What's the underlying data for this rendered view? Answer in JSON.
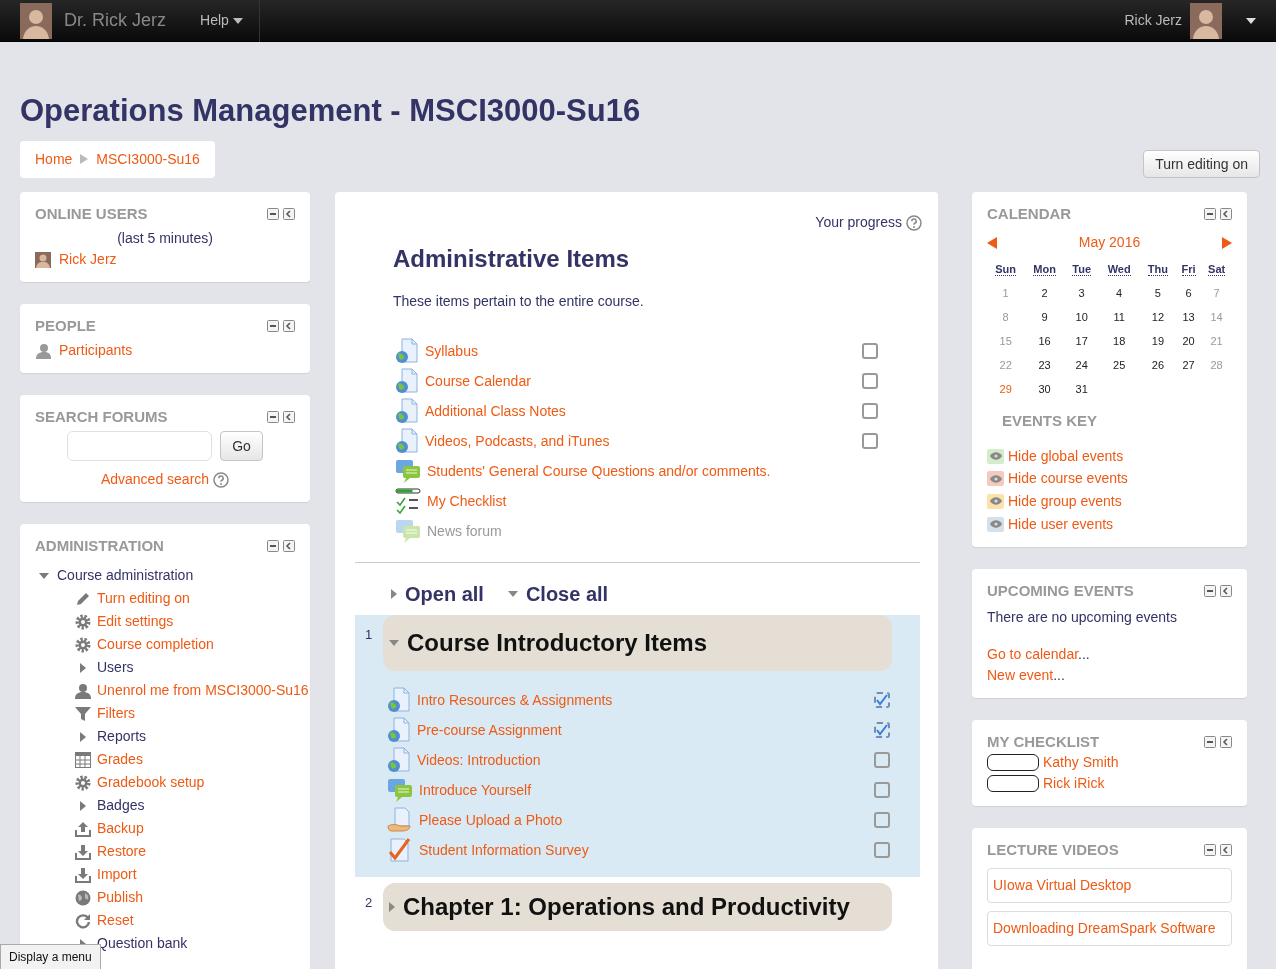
{
  "navbar": {
    "brand": "Dr. Rick Jerz",
    "menu": [
      {
        "label": "Help"
      }
    ],
    "user_name": "Rick Jerz"
  },
  "page_title": "Operations Management - MSCI3000-Su16",
  "breadcrumb": [
    "Home",
    "MSCI3000-Su16"
  ],
  "edit_button": "Turn editing on",
  "online_users": {
    "title": "ONLINE USERS",
    "period": "(last 5 minutes)",
    "users": [
      "Rick Jerz"
    ]
  },
  "people": {
    "title": "PEOPLE",
    "link": "Participants"
  },
  "search_forums": {
    "title": "SEARCH FORUMS",
    "button": "Go",
    "advanced": "Advanced search"
  },
  "administration": {
    "title": "ADMINISTRATION",
    "tree": [
      {
        "label": "Course administration",
        "kind": "branch",
        "expanded": true,
        "children": [
          {
            "label": "Turn editing on",
            "kind": "edit"
          },
          {
            "label": "Edit settings",
            "kind": "settings"
          },
          {
            "label": "Course completion",
            "kind": "settings"
          },
          {
            "label": "Users",
            "kind": "branch",
            "expanded": false
          },
          {
            "label": "Unenrol me from MSCI3000-Su16",
            "kind": "user"
          },
          {
            "label": "Filters",
            "kind": "filter"
          },
          {
            "label": "Reports",
            "kind": "branch",
            "expanded": false
          },
          {
            "label": "Grades",
            "kind": "grades"
          },
          {
            "label": "Gradebook setup",
            "kind": "settings"
          },
          {
            "label": "Badges",
            "kind": "branch",
            "expanded": false
          },
          {
            "label": "Backup",
            "kind": "backup"
          },
          {
            "label": "Restore",
            "kind": "restore"
          },
          {
            "label": "Import",
            "kind": "restore"
          },
          {
            "label": "Publish",
            "kind": "publish"
          },
          {
            "label": "Reset",
            "kind": "reset"
          },
          {
            "label": "Question bank",
            "kind": "branch",
            "expanded": false
          }
        ]
      }
    ]
  },
  "course": {
    "progress_label": "Your progress",
    "intro_section": {
      "title": "Administrative Items",
      "summary": "These items pertain to the entire course.",
      "activities": [
        {
          "name": "Syllabus",
          "kind": "url",
          "hidden": false,
          "completion": {
            "checked": false,
            "automatic": false
          }
        },
        {
          "name": "Course Calendar",
          "kind": "url",
          "hidden": false,
          "completion": {
            "checked": false,
            "automatic": false
          }
        },
        {
          "name": "Additional Class Notes",
          "kind": "url",
          "hidden": false,
          "completion": {
            "checked": false,
            "automatic": false
          }
        },
        {
          "name": "Videos, Podcasts, and iTunes",
          "kind": "url",
          "hidden": false,
          "completion": {
            "checked": false,
            "automatic": false
          }
        },
        {
          "name": "Students' General Course Questions and/or comments.",
          "kind": "forum",
          "hidden": false
        },
        {
          "name": "My Checklist",
          "kind": "checklist",
          "hidden": false
        },
        {
          "name": "News forum",
          "kind": "forum",
          "hidden": true
        }
      ]
    },
    "open_all": "Open all",
    "close_all": "Close all",
    "sections": [
      {
        "number": "1",
        "title": "Course Introductory Items",
        "expanded": true,
        "current": true,
        "activities": [
          {
            "name": "Intro Resources & Assignments",
            "kind": "url",
            "hidden": false,
            "completion": {
              "checked": true,
              "automatic": true
            }
          },
          {
            "name": "Pre-course Assignment",
            "kind": "url",
            "hidden": false,
            "completion": {
              "checked": true,
              "automatic": true
            }
          },
          {
            "name": "Videos: Introduction",
            "kind": "url",
            "hidden": false,
            "completion": {
              "checked": false,
              "automatic": false
            }
          },
          {
            "name": "Introduce Yourself",
            "kind": "forum",
            "hidden": false,
            "completion": {
              "checked": false,
              "automatic": false
            }
          },
          {
            "name": "Please Upload a Photo",
            "kind": "assign",
            "hidden": false,
            "completion": {
              "checked": false,
              "automatic": false
            }
          },
          {
            "name": "Student Information Survey",
            "kind": "survey",
            "hidden": false,
            "completion": {
              "checked": false,
              "automatic": false
            }
          }
        ]
      },
      {
        "number": "2",
        "title": "Chapter 1: Operations and Productivity",
        "expanded": false,
        "current": false
      }
    ]
  },
  "calendar": {
    "title": "CALENDAR",
    "month": "May 2016",
    "weekdays": [
      "Sun",
      "Mon",
      "Tue",
      "Wed",
      "Thu",
      "Fri",
      "Sat"
    ],
    "weeks": [
      [
        {
          "day": "1",
          "today": false
        },
        {
          "day": "2",
          "today": false
        },
        {
          "day": "3",
          "today": false
        },
        {
          "day": "4",
          "today": false
        },
        {
          "day": "5",
          "today": false
        },
        {
          "day": "6",
          "today": false
        },
        {
          "day": "7",
          "today": false
        }
      ],
      [
        {
          "day": "8",
          "today": false
        },
        {
          "day": "9",
          "today": false
        },
        {
          "day": "10",
          "today": false
        },
        {
          "day": "11",
          "today": false
        },
        {
          "day": "12",
          "today": false
        },
        {
          "day": "13",
          "today": false
        },
        {
          "day": "14",
          "today": false
        }
      ],
      [
        {
          "day": "15",
          "today": false
        },
        {
          "day": "16",
          "today": false
        },
        {
          "day": "17",
          "today": false
        },
        {
          "day": "18",
          "today": false
        },
        {
          "day": "19",
          "today": false
        },
        {
          "day": "20",
          "today": false
        },
        {
          "day": "21",
          "today": false
        }
      ],
      [
        {
          "day": "22",
          "today": false
        },
        {
          "day": "23",
          "today": false
        },
        {
          "day": "24",
          "today": false
        },
        {
          "day": "25",
          "today": false
        },
        {
          "day": "26",
          "today": false
        },
        {
          "day": "27",
          "today": false
        },
        {
          "day": "28",
          "today": false
        }
      ],
      [
        {
          "day": "29",
          "today": true
        },
        {
          "day": "30",
          "today": false
        },
        {
          "day": "31",
          "today": false
        }
      ]
    ],
    "events_key_title": "EVENTS KEY",
    "events_key": [
      {
        "label": "Hide global events",
        "color": "#d3ecc9"
      },
      {
        "label": "Hide course events",
        "color": "#f5c9bf"
      },
      {
        "label": "Hide group events",
        "color": "#fbe2aa"
      },
      {
        "label": "Hide user events",
        "color": "#d5e1ea"
      }
    ]
  },
  "upcoming_events": {
    "title": "UPCOMING EVENTS",
    "message": "There are no upcoming events",
    "links": [
      {
        "label": "Go to calendar",
        "suffix": "..."
      },
      {
        "label": "New event",
        "suffix": "..."
      }
    ]
  },
  "my_checklist": {
    "title": "MY CHECKLIST",
    "students": [
      {
        "name": "Kathy Smith",
        "level": 0
      },
      {
        "name": "Rick iRick",
        "level": 0
      }
    ]
  },
  "lecture_videos": {
    "title": "LECTURE VIDEOS",
    "links": [
      "UIowa Virtual Desktop",
      "Downloading DreamSpark Software"
    ]
  },
  "tooltip": "Display a menu"
}
